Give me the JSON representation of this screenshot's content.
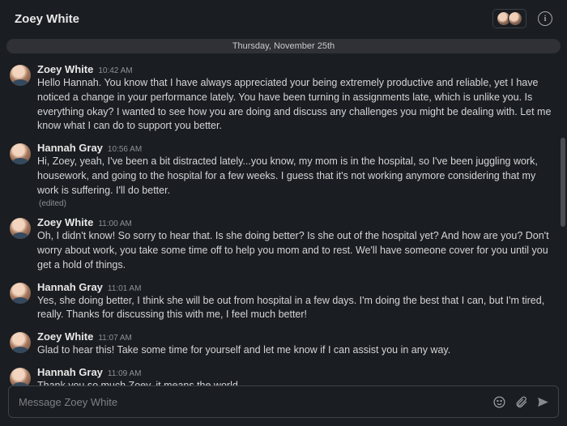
{
  "header": {
    "title": "Zoey White"
  },
  "date_divider": "Thursday, November 25th",
  "messages": [
    {
      "author": "Zoey White",
      "time": "10:42 AM",
      "text": "Hello Hannah. You know that I have always appreciated your being extremely productive and reliable, yet I have noticed a change in your performance lately. You have been turning in assignments late, which is unlike you. Is everything okay? I wanted to see how you are doing and discuss any challenges you might be dealing with. Let me know what I can do to support you better.",
      "edited": ""
    },
    {
      "author": "Hannah Gray",
      "time": "10:56 AM",
      "text": "Hi, Zoey, yeah, I've been a bit distracted lately...you know, my mom is in the hospital, so I've been juggling work, housework, and going to the hospital for a few weeks. I guess that it's not working anymore considering that my work is suffering. I'll do better.",
      "edited": "(edited)"
    },
    {
      "author": "Zoey White",
      "time": "11:00 AM",
      "text": "Oh, I didn't know! So sorry to hear that. Is she doing better? Is she out of the hospital yet? And how are you? Don't worry about work, you take some time off to help you mom and to rest. We'll have someone cover for you until you get a hold of things.",
      "edited": ""
    },
    {
      "author": "Hannah Gray",
      "time": "11:01 AM",
      "text": "Yes, she doing better, I think she will be out from hospital in a few days. I'm doing the best that I can, but I'm tired, really. Thanks for discussing this with me, I feel much better!",
      "edited": ""
    },
    {
      "author": "Zoey White",
      "time": "11:07 AM",
      "text": "Glad to hear this! Take some time for yourself and let me know if I can assist you in any way.",
      "edited": ""
    },
    {
      "author": "Hannah Gray",
      "time": "11:09 AM",
      "text": "Thank you so much Zoey, it means the world.",
      "edited": ""
    }
  ],
  "composer": {
    "placeholder": "Message Zoey White"
  }
}
